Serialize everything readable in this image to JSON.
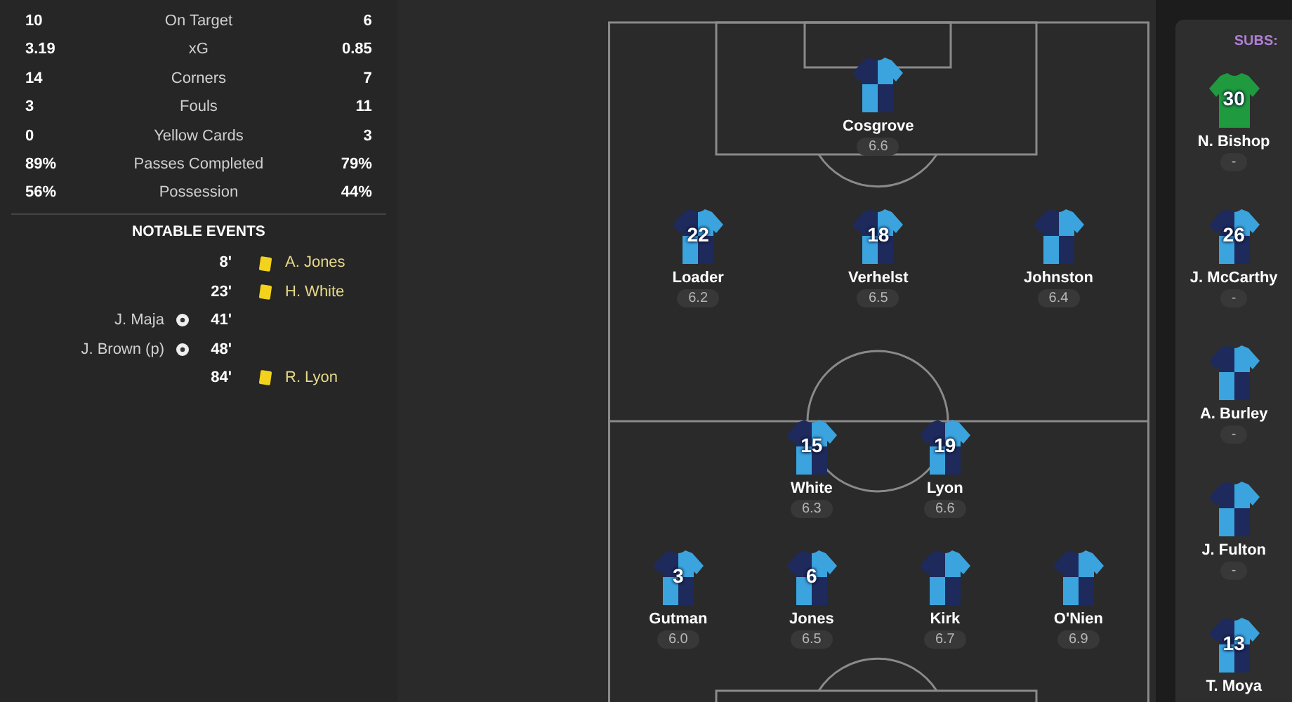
{
  "stats": [
    {
      "home": "10",
      "label": "On Target",
      "away": "6"
    },
    {
      "home": "3.19",
      "label": "xG",
      "away": "0.85"
    },
    {
      "home": "14",
      "label": "Corners",
      "away": "7"
    },
    {
      "home": "3",
      "label": "Fouls",
      "away": "11"
    },
    {
      "home": "0",
      "label": "Yellow Cards",
      "away": "3"
    },
    {
      "home": "89%",
      "label": "Passes Completed",
      "away": "79%"
    },
    {
      "home": "56%",
      "label": "Possession",
      "away": "44%"
    }
  ],
  "events_title": "NOTABLE EVENTS",
  "events": [
    {
      "kind": "away_card",
      "minute": "8'",
      "player": "A. Jones"
    },
    {
      "kind": "away_card",
      "minute": "23'",
      "player": "H. White"
    },
    {
      "kind": "home_goal",
      "minute": "41'",
      "player": "J. Maja"
    },
    {
      "kind": "home_goal",
      "minute": "48'",
      "player": "J. Brown (p)"
    },
    {
      "kind": "away_card",
      "minute": "84'",
      "player": "R. Lyon"
    }
  ],
  "lineup": [
    [
      {
        "name": "Cosgrove",
        "rating": "6.6"
      }
    ],
    [
      {
        "name": "Loader",
        "rating": "6.2",
        "number": "22"
      },
      {
        "name": "Verhelst",
        "rating": "6.5",
        "number": "18"
      },
      {
        "name": "Johnston",
        "rating": "6.4"
      }
    ],
    [
      {
        "name": "White",
        "rating": "6.3",
        "number": "15"
      },
      {
        "name": "Lyon",
        "rating": "6.6",
        "number": "19"
      }
    ],
    [
      {
        "name": "Gutman",
        "rating": "6.0",
        "number": "3"
      },
      {
        "name": "Jones",
        "rating": "6.5",
        "number": "6"
      },
      {
        "name": "Kirk",
        "rating": "6.7"
      },
      {
        "name": "O'Nien",
        "rating": "6.9"
      }
    ]
  ],
  "subs_title": "SUBS:",
  "subs": [
    {
      "kind": "goalkeeper",
      "name": "N. Bishop",
      "rating": "-",
      "number": "30"
    },
    {
      "kind": "outfield",
      "name": "J. McCarthy",
      "rating": "-",
      "number": "26"
    },
    {
      "kind": "outfield",
      "name": "A. Burley",
      "rating": "-"
    },
    {
      "kind": "outfield",
      "name": "J. Fulton",
      "rating": "-"
    },
    {
      "kind": "outfield",
      "name": "T. Moya",
      "number": "13"
    }
  ]
}
